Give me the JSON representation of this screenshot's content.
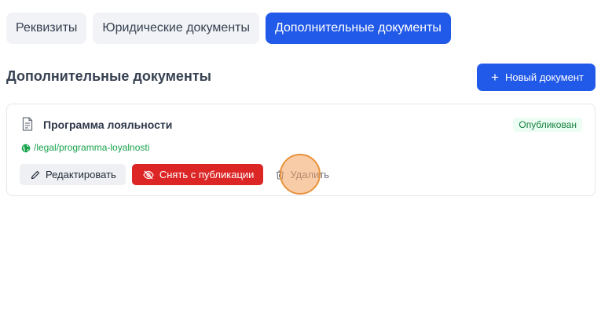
{
  "tabs": [
    {
      "label": "Реквизиты",
      "active": false
    },
    {
      "label": "Юридические документы",
      "active": false
    },
    {
      "label": "Дополнительные документы",
      "active": true
    }
  ],
  "section": {
    "title": "Дополнительные документы",
    "new_button_label": "Новый документ",
    "new_button_icon": "plus-icon"
  },
  "documents": [
    {
      "title": "Программа лояльности",
      "icon": "file-text-icon",
      "status": "Опубликован",
      "link": "/legal/programma-loyalnosti",
      "link_icon": "globe-icon",
      "actions": {
        "edit_label": "Редактировать",
        "edit_icon": "pencil-icon",
        "unpublish_label": "Снять с публикации",
        "unpublish_icon": "eye-off-icon",
        "delete_label": "Удалить",
        "delete_icon": "trash-icon"
      }
    }
  ],
  "colors": {
    "primary": "#2159e8",
    "danger": "#dc2626",
    "success_text": "#15803d",
    "success_bg": "#ecfdf3",
    "click_marker": "#f4a261"
  }
}
